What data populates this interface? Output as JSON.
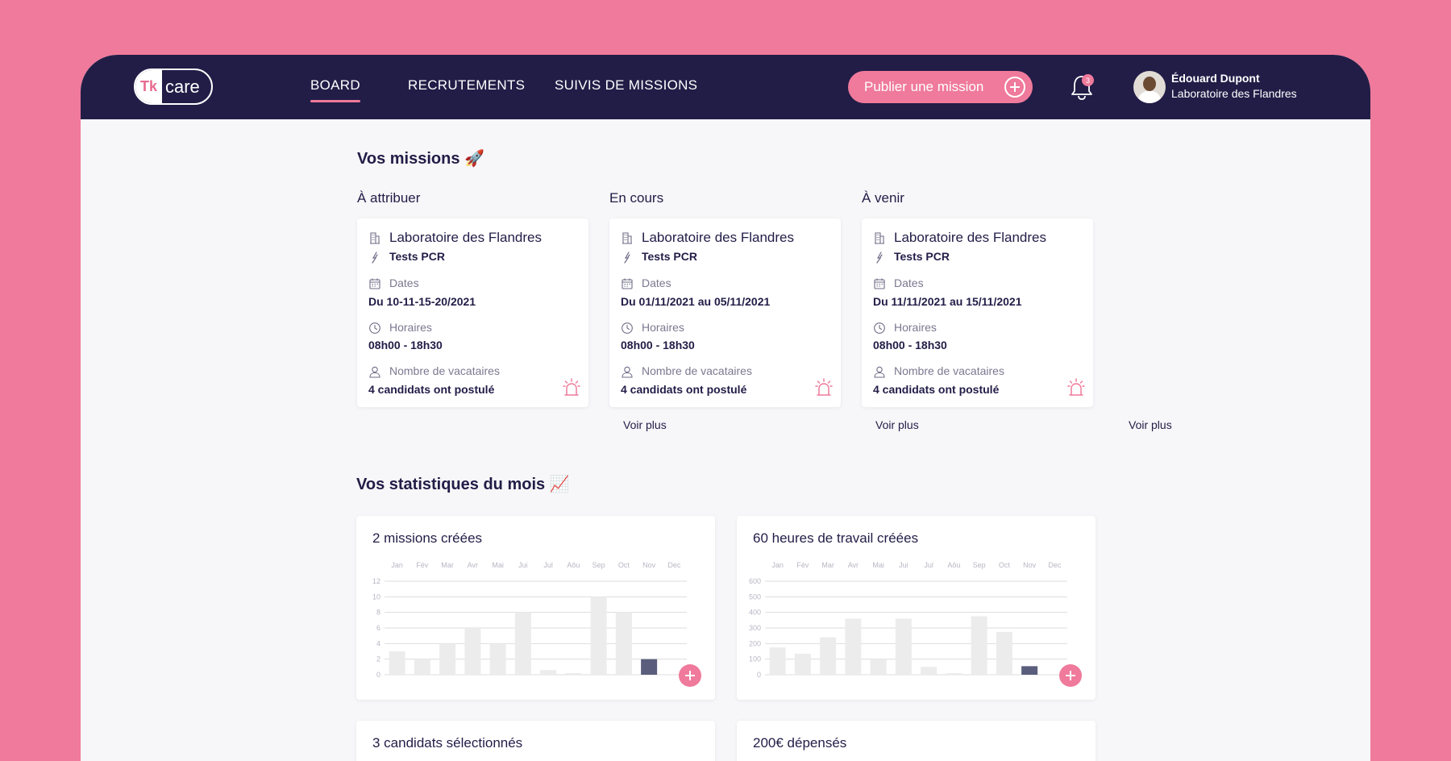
{
  "app": {
    "logo_prefix": "Tk",
    "logo_suffix": "care"
  },
  "nav": {
    "tabs": [
      {
        "label": "BOARD",
        "active": true
      },
      {
        "label": "RECRUTEMENTS",
        "active": false
      },
      {
        "label": "SUIVIS DE MISSIONS",
        "active": false
      }
    ],
    "publish_label": "Publier une mission",
    "notification_count": "3",
    "user_name": "Édouard Dupont",
    "user_org": "Laboratoire des Flandres"
  },
  "missions": {
    "title": "Vos missions 🚀",
    "columns": [
      {
        "title": "À attribuer",
        "lab": "Laboratoire des Flandres",
        "test": "Tests PCR",
        "dates_label": "Dates",
        "dates": "Du 10-11-15-20/2021",
        "hours_label": "Horaires",
        "hours": "08h00 - 18h30",
        "staff_label": "Nombre de vacataires",
        "staff": "4 candidats ont postulé",
        "more": "Voir plus"
      },
      {
        "title": "En cours",
        "lab": "Laboratoire des Flandres",
        "test": "Tests PCR",
        "dates_label": "Dates",
        "dates": "Du 01/11/2021 au 05/11/2021",
        "hours_label": "Horaires",
        "hours": "08h00 - 18h30",
        "staff_label": "Nombre de vacataires",
        "staff": "4 candidats ont postulé",
        "more": "Voir plus"
      },
      {
        "title": "À venir",
        "lab": "Laboratoire des Flandres",
        "test": "Tests PCR",
        "dates_label": "Dates",
        "dates": "Du 11/11/2021 au 15/11/2021",
        "hours_label": "Horaires",
        "hours": "08h00 - 18h30",
        "staff_label": "Nombre de vacataires",
        "staff": "4 candidats ont postulé",
        "more": "Voir plus"
      }
    ]
  },
  "stats": {
    "title": "Vos statistiques du mois 📈",
    "cards": [
      {
        "title": "2 missions créées"
      },
      {
        "title": "60 heures de travail créées"
      },
      {
        "title": "3 candidats sélectionnés"
      },
      {
        "title": "200€ dépensés"
      }
    ]
  },
  "colors": {
    "accent": "#ef7a9b",
    "navy": "#221d47",
    "bar": "#ececec",
    "bar_current": "#5a5e7c"
  },
  "chart_data": [
    {
      "type": "bar",
      "categories": [
        "Jan",
        "Fév",
        "Mar",
        "Avr",
        "Mai",
        "Jui",
        "Jul",
        "Aôu",
        "Sep",
        "Oct",
        "Nov",
        "Dec"
      ],
      "values": [
        3,
        2,
        4,
        6,
        4,
        8,
        0.6,
        0.2,
        10,
        8,
        2,
        0
      ],
      "yticks": [
        0,
        2,
        4,
        6,
        8,
        10,
        12
      ],
      "ylim": [
        0,
        12
      ],
      "highlight_index": 10
    },
    {
      "type": "bar",
      "categories": [
        "Jan",
        "Fév",
        "Mar",
        "Avr",
        "Mai",
        "Jui",
        "Jul",
        "Aôu",
        "Sep",
        "Oct",
        "Nov",
        "Dec"
      ],
      "values": [
        175,
        135,
        240,
        360,
        100,
        360,
        50,
        10,
        375,
        275,
        55,
        0
      ],
      "yticks": [
        0,
        100,
        200,
        300,
        400,
        500,
        600
      ],
      "ylim": [
        0,
        600
      ],
      "highlight_index": 10
    }
  ]
}
